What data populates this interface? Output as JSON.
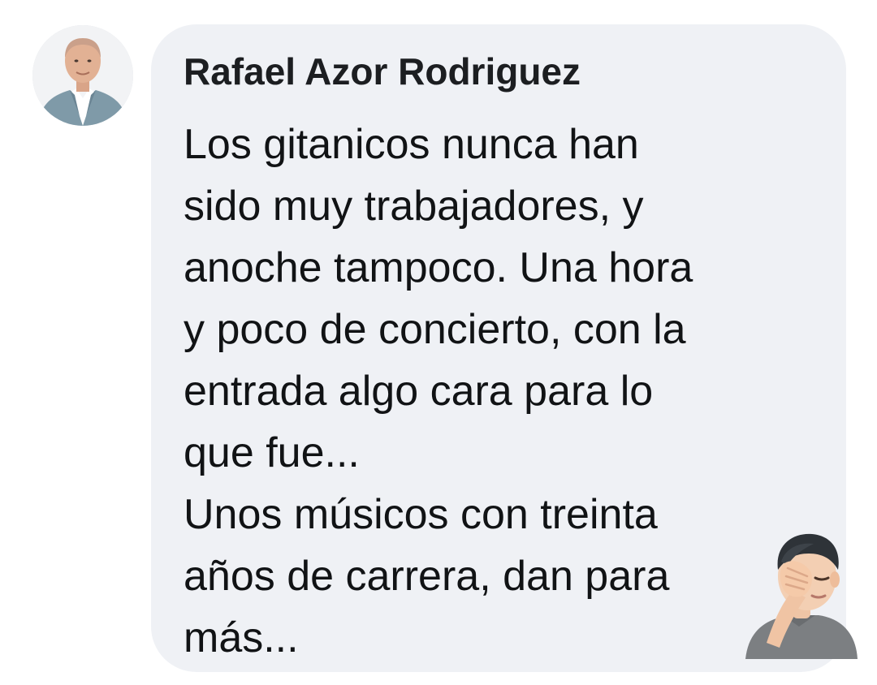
{
  "comment": {
    "author": "Rafael Azor Rodriguez",
    "lines": [
      "Los gitanicos nunca han",
      "sido muy trabajadores, y",
      "anoche tampoco. Una hora",
      "y poco de concierto, con la",
      "entrada algo cara para lo",
      "que fue...",
      "Unos músicos con treinta",
      "años de carrera, dan para",
      "más..."
    ],
    "avatar_icon": "profile-photo-man-in-suit",
    "emoji_icon": "facepalm-memoji",
    "colors": {
      "bubble": "#eff1f5",
      "text": "#111315",
      "author": "#1c1e21"
    }
  }
}
